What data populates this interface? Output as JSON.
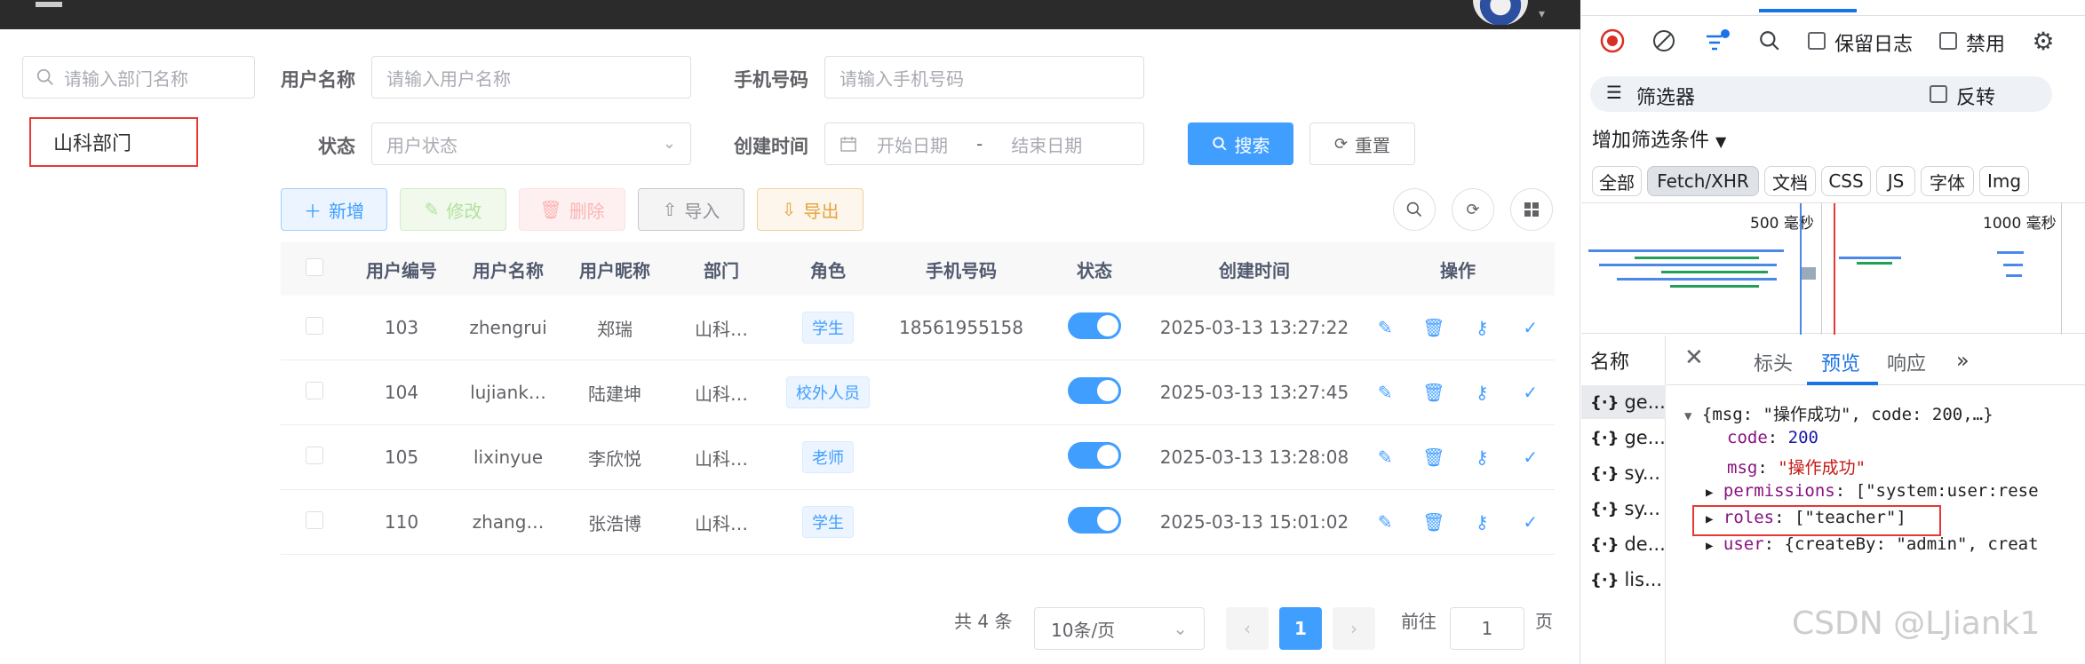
{
  "sidebar": {
    "dept_search_placeholder": "请输入部门名称",
    "dept_node": "山科部门"
  },
  "filters": {
    "username_label": "用户名称",
    "username_placeholder": "请输入用户名称",
    "phone_label": "手机号码",
    "phone_placeholder": "请输入手机号码",
    "status_label": "状态",
    "status_placeholder": "用户状态",
    "created_label": "创建时间",
    "start_placeholder": "开始日期",
    "range_sep": "-",
    "end_placeholder": "结束日期",
    "search_btn": "搜索",
    "reset_btn": "重置"
  },
  "toolbar": {
    "add": "新增",
    "edit": "修改",
    "delete": "删除",
    "import": "导入",
    "export": "导出"
  },
  "table": {
    "headers": [
      "用户编号",
      "用户名称",
      "用户昵称",
      "部门",
      "角色",
      "手机号码",
      "状态",
      "创建时间",
      "操作"
    ],
    "rows": [
      {
        "id": "103",
        "username": "zhengrui",
        "nickname": "郑瑞",
        "dept": "山科…",
        "role": "学生",
        "phone": "18561955158",
        "enabled": true,
        "created": "2025-03-13 13:27:22"
      },
      {
        "id": "104",
        "username": "lujiank…",
        "nickname": "陆建坤",
        "dept": "山科…",
        "role": "校外人员",
        "phone": "",
        "enabled": true,
        "created": "2025-03-13 13:27:45"
      },
      {
        "id": "105",
        "username": "lixinyue",
        "nickname": "李欣悦",
        "dept": "山科…",
        "role": "老师",
        "phone": "",
        "enabled": true,
        "created": "2025-03-13 13:28:08"
      },
      {
        "id": "110",
        "username": "zhang…",
        "nickname": "张浩博",
        "dept": "山科…",
        "role": "学生",
        "phone": "",
        "enabled": true,
        "created": "2025-03-13 15:01:02"
      }
    ]
  },
  "pagination": {
    "total": "共 4 条",
    "page_size": "10条/页",
    "current": "1",
    "goto_label": "前往",
    "goto_value": "1",
    "page_suffix": "页"
  },
  "devtools": {
    "preserve_log": "保留日志",
    "disable_cache": "禁用",
    "filter_label": "筛选器",
    "invert": "反转",
    "more_filters": "增加筛选条件",
    "filter_tabs": [
      "全部",
      "Fetch/XHR",
      "文档",
      "CSS",
      "JS",
      "字体",
      "Img"
    ],
    "tick_500": "500 毫秒",
    "tick_1000": "1000 毫秒",
    "name_header": "名称",
    "requests": [
      "ge...",
      "ge...",
      "sy...",
      "sy...",
      "de...",
      "lis..."
    ],
    "tabs": [
      "标头",
      "预览",
      "响应"
    ],
    "preview": {
      "summary": "{msg: \"操作成功\", code: 200,…}",
      "code_key": "code",
      "code_val": "200",
      "msg_key": "msg",
      "msg_val": "\"操作成功\"",
      "perm_key": "permissions",
      "perm_val": "[\"system:user:rese",
      "roles_key": "roles",
      "roles_val": "[\"teacher\"]",
      "user_key": "user",
      "user_val": "{createBy: \"admin\", creat"
    }
  },
  "watermark": "CSDN @LJiank1",
  "colors": {
    "primary": "#409eff",
    "highlight": "#e53935"
  }
}
